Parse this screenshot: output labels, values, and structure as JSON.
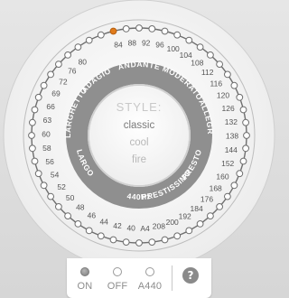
{
  "dial": {
    "tempo_ticks": [
      "84",
      "88",
      "92",
      "96",
      "100",
      "104",
      "108",
      "112",
      "116",
      "120",
      "126",
      "132",
      "138",
      "144",
      "152",
      "160",
      "168",
      "176",
      "184",
      "192",
      "200",
      "208",
      "A4",
      "40",
      "42",
      "44",
      "46",
      "48",
      "50",
      "52",
      "54",
      "56",
      "58",
      "60",
      "63",
      "66",
      "69",
      "72",
      "76",
      "80"
    ],
    "selected_tick": "90",
    "tempo_markings": [
      "ANDANTE",
      "MODERATO",
      "ALLEGRO",
      "PRESTO",
      "PRESTISSIMO",
      "440Hz",
      "LARGO",
      "LARGHETTO",
      "ADAGIO"
    ],
    "style_label": "STYLE:",
    "styles": [
      "classic",
      "cool",
      "fire"
    ],
    "selected_style": "classic"
  },
  "bottom": {
    "options": [
      {
        "label": "ON",
        "selected": true
      },
      {
        "label": "OFF",
        "selected": false
      },
      {
        "label": "A440",
        "selected": false
      }
    ],
    "help_label": "?"
  },
  "colors": {
    "accent": "#e07b1a",
    "ring_gray": "#8f8f8f",
    "panel": "#ffffff"
  }
}
